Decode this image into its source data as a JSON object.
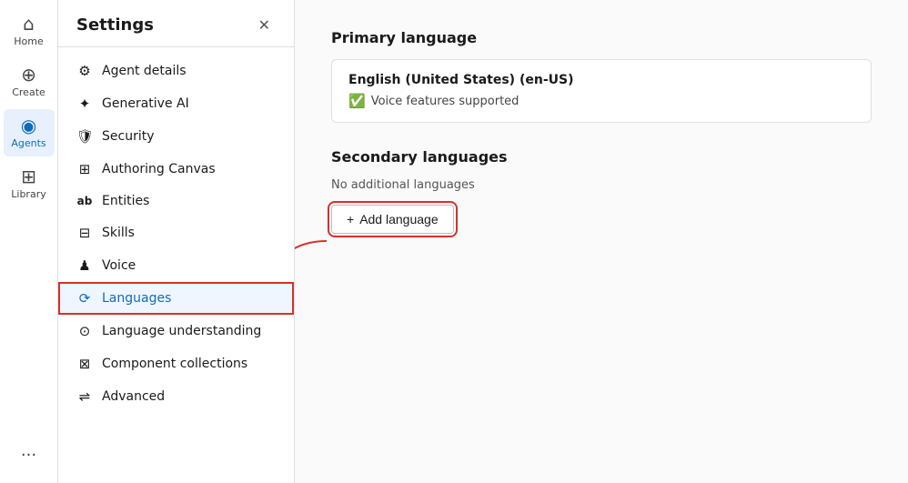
{
  "nav": {
    "items": [
      {
        "id": "home",
        "label": "Home",
        "icon": "⌂",
        "active": false
      },
      {
        "id": "create",
        "label": "Create",
        "icon": "⊕",
        "active": false
      },
      {
        "id": "agents",
        "label": "Agents",
        "icon": "◉",
        "active": true
      },
      {
        "id": "library",
        "label": "Library",
        "icon": "⊞",
        "active": false
      }
    ],
    "more_label": "..."
  },
  "settings": {
    "title": "Settings",
    "close_label": "✕",
    "nav_items": [
      {
        "id": "agent-details",
        "label": "Agent details",
        "icon": "⚙",
        "active": false
      },
      {
        "id": "generative-ai",
        "label": "Generative AI",
        "icon": "✦",
        "active": false
      },
      {
        "id": "security",
        "label": "Security",
        "icon": "🛡",
        "active": false
      },
      {
        "id": "authoring-canvas",
        "label": "Authoring Canvas",
        "icon": "⊞",
        "active": false
      },
      {
        "id": "entities",
        "label": "Entities",
        "icon": "ab",
        "active": false
      },
      {
        "id": "skills",
        "label": "Skills",
        "icon": "⊟",
        "active": false
      },
      {
        "id": "voice",
        "label": "Voice",
        "icon": "♟",
        "active": false
      },
      {
        "id": "languages",
        "label": "Languages",
        "icon": "⟳",
        "active": true
      },
      {
        "id": "language-understanding",
        "label": "Language understanding",
        "icon": "⊙",
        "active": false
      },
      {
        "id": "component-collections",
        "label": "Component collections",
        "icon": "⊠",
        "active": false
      },
      {
        "id": "advanced",
        "label": "Advanced",
        "icon": "⇌",
        "active": false
      }
    ]
  },
  "main": {
    "primary_language_section": "Primary language",
    "primary_language_name": "English (United States) (en-US)",
    "voice_support_text": "Voice features supported",
    "secondary_languages_section": "Secondary languages",
    "no_languages_text": "No additional languages",
    "add_language_label": "Add language"
  }
}
